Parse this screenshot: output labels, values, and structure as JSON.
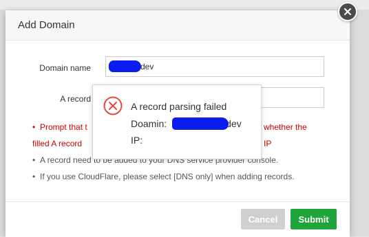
{
  "modal": {
    "title": "Add Domain"
  },
  "form": {
    "domain_label": "Domain name",
    "domain_value": "dev",
    "arecord_label": "A record",
    "arecord_value": ""
  },
  "notes": {
    "prompt_left": "Prompt that t",
    "prompt_right": "whether the",
    "prompt2_left": "filled A record",
    "prompt2_right": "ver IP",
    "note2": "A record need to be added to your DNS service provider console.",
    "note3": "If you use CloudFlare, please select [DNS only] when adding records."
  },
  "buttons": {
    "cancel": "Cancel",
    "submit": "Submit"
  },
  "popup": {
    "title": "A record parsing failed",
    "domain_label": "Doamin:",
    "domain_suffix": "dev",
    "ip_label": "IP:"
  },
  "colors": {
    "submit": "#20a53a",
    "cancel": "#cfcfcf",
    "error_red": "#cc0000",
    "redaction": "#0a1cf0"
  }
}
